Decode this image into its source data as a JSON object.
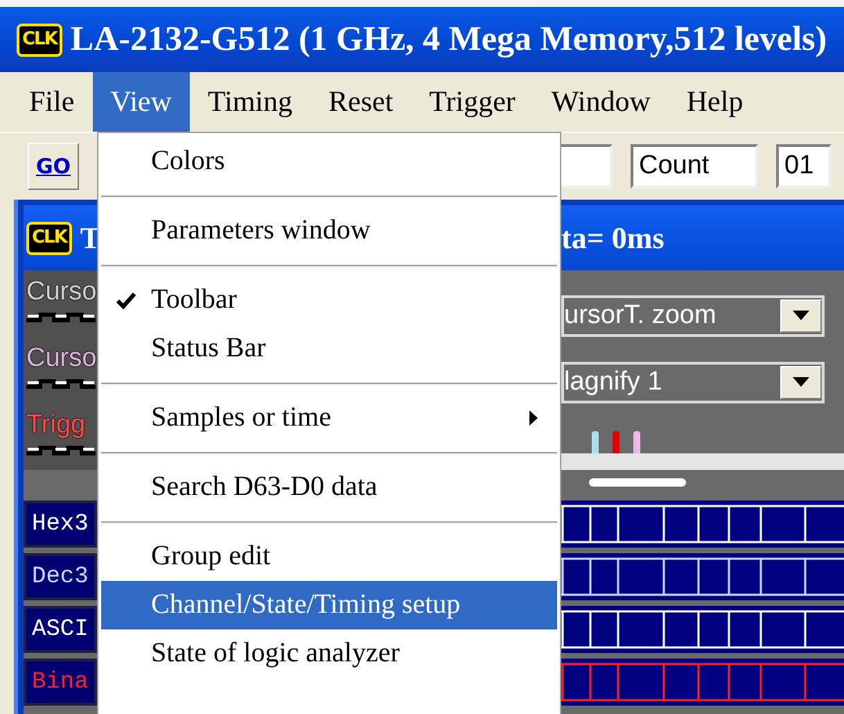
{
  "window": {
    "logo": "CLK",
    "title": "LA-2132-G512 (1 GHz, 4 Mega Memory,512 levels)"
  },
  "menu_bar": [
    {
      "label": "File",
      "selected": false
    },
    {
      "label": "View",
      "selected": true
    },
    {
      "label": "Timing",
      "selected": false
    },
    {
      "label": "Reset",
      "selected": false
    },
    {
      "label": "Trigger",
      "selected": false
    },
    {
      "label": "Window",
      "selected": false
    },
    {
      "label": "Help",
      "selected": false
    }
  ],
  "toolbar": {
    "go_button": "GO",
    "count_field": "Count",
    "field_3": "01"
  },
  "view_menu": [
    {
      "kind": "item",
      "label": "Colors",
      "checked": false,
      "submenu": false,
      "selected": false
    },
    {
      "kind": "separator"
    },
    {
      "kind": "item",
      "label": "Parameters window",
      "checked": false,
      "submenu": false,
      "selected": false
    },
    {
      "kind": "separator"
    },
    {
      "kind": "item",
      "label": "Toolbar",
      "checked": true,
      "submenu": false,
      "selected": false
    },
    {
      "kind": "item",
      "label": "Status Bar",
      "checked": false,
      "submenu": false,
      "selected": false
    },
    {
      "kind": "separator"
    },
    {
      "kind": "item",
      "label": "Samples or time",
      "checked": false,
      "submenu": true,
      "selected": false
    },
    {
      "kind": "separator"
    },
    {
      "kind": "item",
      "label": "Search D63-D0 data",
      "checked": false,
      "submenu": false,
      "selected": false
    },
    {
      "kind": "separator"
    },
    {
      "kind": "item",
      "label": "Group edit",
      "checked": false,
      "submenu": false,
      "selected": false
    },
    {
      "kind": "item",
      "label": "Channel/State/Timing setup",
      "checked": false,
      "submenu": false,
      "selected": true
    },
    {
      "kind": "item",
      "label": "State of logic analyzer",
      "checked": false,
      "submenu": false,
      "selected": false
    }
  ],
  "child_window": {
    "logo": "CLK",
    "title_start": "T",
    "title_end": "ta= 0ms",
    "signals": [
      {
        "label": "Curso",
        "color": "#d0d0d0"
      },
      {
        "label": "Curso",
        "color": "#e0b0e0"
      },
      {
        "label": "Trigg",
        "color": "#ff4848"
      }
    ],
    "combos": [
      {
        "value": "ursorT. zoom"
      },
      {
        "value": "lagnify 1"
      }
    ],
    "markers": [
      {
        "color": "#a8e0f0"
      },
      {
        "color": "#e00000"
      },
      {
        "color": "#f0b8e8"
      }
    ],
    "channels": [
      {
        "label": "Hex3",
        "color": "#ffffff"
      },
      {
        "label": "Dec3",
        "color": "#c8d8ff"
      },
      {
        "label": "ASCI",
        "color": "#ffffff"
      },
      {
        "label": "Bina",
        "color": "#ff2020"
      }
    ]
  }
}
